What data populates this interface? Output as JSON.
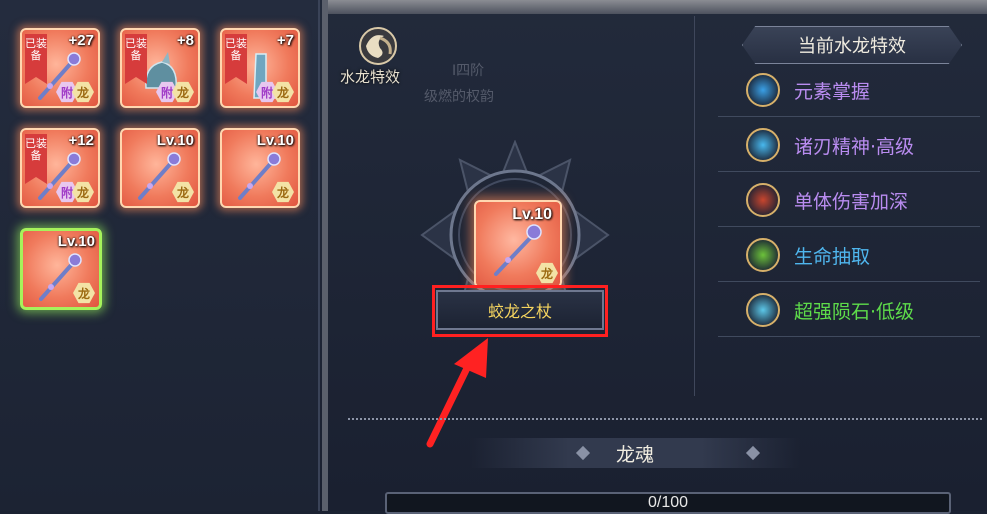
{
  "inventory": {
    "slots": [
      {
        "level": "+27",
        "equipped_label": "已装备",
        "fu_badge": "附",
        "long_badge": "龙",
        "kind": "staff"
      },
      {
        "level": "+8",
        "equipped_label": "已装备",
        "fu_badge": "附",
        "long_badge": "龙",
        "kind": "helmet"
      },
      {
        "level": "+7",
        "equipped_label": "已装备",
        "fu_badge": "附",
        "long_badge": "龙",
        "kind": "boots"
      },
      {
        "level": "+12",
        "equipped_label": "已装备",
        "fu_badge": "附",
        "long_badge": "龙",
        "kind": "staff"
      },
      {
        "level": "Lv.10",
        "long_badge": "龙",
        "kind": "staff"
      },
      {
        "level": "Lv.10",
        "long_badge": "龙",
        "kind": "staff"
      },
      {
        "level": "Lv.10",
        "long_badge": "龙",
        "kind": "staff"
      }
    ]
  },
  "emblem": {
    "title": "水龙特效"
  },
  "background_text": {
    "line1": "I四阶",
    "line2": "级燃的权韵"
  },
  "featured_item": {
    "level": "Lv.10",
    "long_badge": "龙",
    "name": "蛟龙之杖"
  },
  "effects": {
    "header": "当前水龙特效",
    "items": [
      {
        "label": "元素掌握",
        "color": "#b98cf0",
        "icon": "element-mastery-icon",
        "icon_color": "#3aa0e6"
      },
      {
        "label": "诸刃精神·高级",
        "color": "#b98cf0",
        "icon": "blade-spirit-icon",
        "icon_color": "#48b8ee"
      },
      {
        "label": "单体伤害加深",
        "color": "#b98cf0",
        "icon": "single-target-icon",
        "icon_color": "#c8452e"
      },
      {
        "label": "生命抽取",
        "color": "#4fb6ee",
        "icon": "life-drain-icon",
        "icon_color": "#6cc23a"
      },
      {
        "label": "超强陨石·低级",
        "color": "#5edc4a",
        "icon": "meteor-icon",
        "icon_color": "#5cc7e8"
      }
    ]
  },
  "dragon_soul": {
    "label": "龙魂",
    "progress_text": "0/100",
    "progress": 0
  }
}
